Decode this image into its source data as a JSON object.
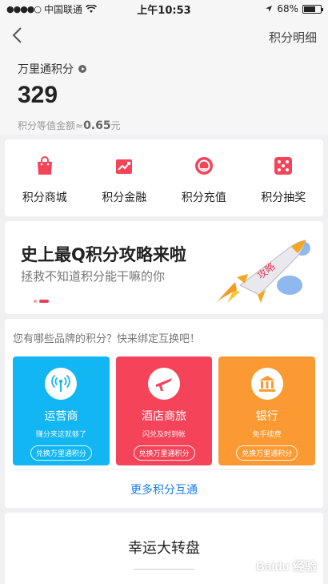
{
  "status_bar": {
    "signal": "●●●●○",
    "carrier": "中国联通",
    "time": "上午10:53",
    "battery": "68%",
    "battery_level": 0.68
  },
  "nav": {
    "back_icon": "chevron-left-icon",
    "right_label": "积分明细"
  },
  "points": {
    "label": "万里通积分",
    "value": "329",
    "equiv_label": "积分等值金额≈",
    "equiv_value": "0.65",
    "equiv_unit": "元"
  },
  "quick_actions": [
    {
      "label": "积分商城",
      "icon": "shopping-bag-icon"
    },
    {
      "label": "积分金融",
      "icon": "finance-chart-icon"
    },
    {
      "label": "积分充值",
      "icon": "recharge-icon"
    },
    {
      "label": "积分抽奖",
      "icon": "dice-icon"
    }
  ],
  "banner": {
    "title": "史上最Q积分攻略来啦",
    "subtitle": "拯救不知道积分能干嘛的你",
    "rocket_text": "攻略"
  },
  "brands": {
    "prompt": "您有哪些品牌的积分？快来绑定互换吧！",
    "tiles": [
      {
        "name": "运营商",
        "desc": "赚分来这就够了",
        "button": "兑换万里通积分",
        "color": "#12b6f2",
        "icon": "antenna-icon"
      },
      {
        "name": "酒店商旅",
        "desc": "闪兑及时到帐",
        "button": "兑换万里通积分",
        "color": "#f5445a",
        "icon": "airplane-icon"
      },
      {
        "name": "银行",
        "desc": "免手续费",
        "button": "兑换万里通积分",
        "color": "#fb9a33",
        "icon": "bank-icon"
      }
    ],
    "more": "更多积分互通"
  },
  "wheel": {
    "title": "幸运大转盘"
  },
  "watermark": "Baidu 经验"
}
